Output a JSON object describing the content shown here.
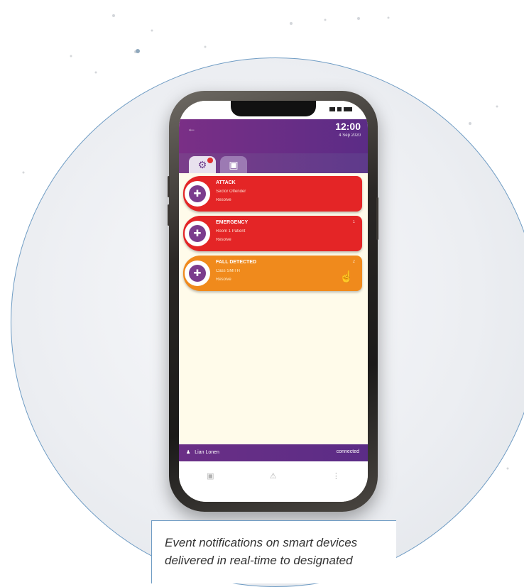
{
  "app": {
    "time": "12:00",
    "date": "4 Sep 2020",
    "tab_alerts_icon": "alarm-icon",
    "tab_events_icon": "calendar-icon"
  },
  "events": [
    {
      "title": "ATTACK",
      "line2": "Sector Offender",
      "line3": "Resolve",
      "color": "#e42526",
      "count": ""
    },
    {
      "title": "EMERGENCY",
      "line2": "Room 1 Patient",
      "line3": "Resolve",
      "color": "#e42526",
      "count": "1"
    },
    {
      "title": "FALL DETECTED",
      "line2": "Cass SMITH",
      "line3": "Resolve",
      "color": "#f08a1c",
      "count": "2"
    }
  ],
  "bottombar": {
    "user": "Lian Lonen",
    "status": "connected"
  },
  "caption": {
    "text": "Event notifications on smart devices delivered in real-time to designated"
  },
  "colors": {
    "accent": "#6a2f86",
    "alert_red": "#e42526",
    "alert_orange": "#f08a1c",
    "circle_border": "#6f9cc4"
  }
}
